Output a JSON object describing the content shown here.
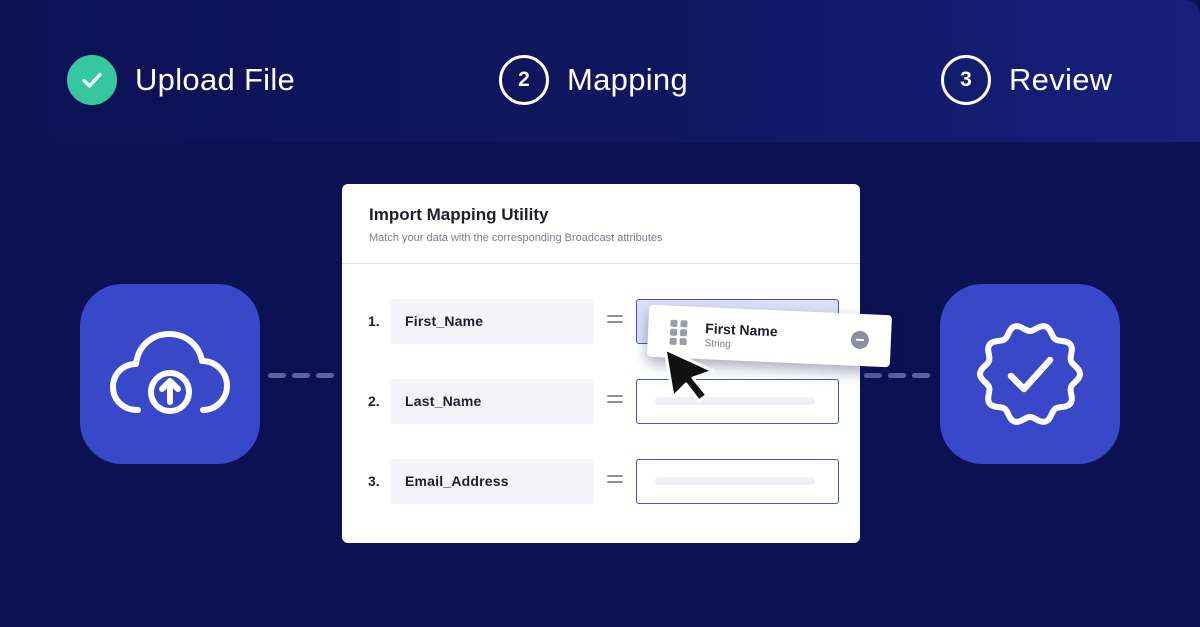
{
  "steps": [
    {
      "number": "",
      "label": "Upload File",
      "state": "complete",
      "icon": "check-icon"
    },
    {
      "number": "2",
      "label": "Mapping",
      "state": "current"
    },
    {
      "number": "3",
      "label": "Review",
      "state": "upcoming"
    }
  ],
  "tiles": {
    "left_icon": "cloud-upload-icon",
    "right_icon": "verified-badge-icon"
  },
  "card": {
    "title": "Import Mapping Utility",
    "subtitle": "Match your data with the corresponding Broadcast attributes",
    "rows": [
      {
        "number": "1.",
        "source": "First_Name"
      },
      {
        "number": "2.",
        "source": "Last_Name"
      },
      {
        "number": "3.",
        "source": "Email_Address"
      }
    ]
  },
  "drag_chip": {
    "name": "First Name",
    "type": "String",
    "icon": "drag-handle-icon",
    "remove_icon": "remove-icon"
  },
  "colors": {
    "background": "#0c1154",
    "tile": "#3848c9",
    "success": "#34c7a0",
    "target_border": "#4453c8"
  }
}
